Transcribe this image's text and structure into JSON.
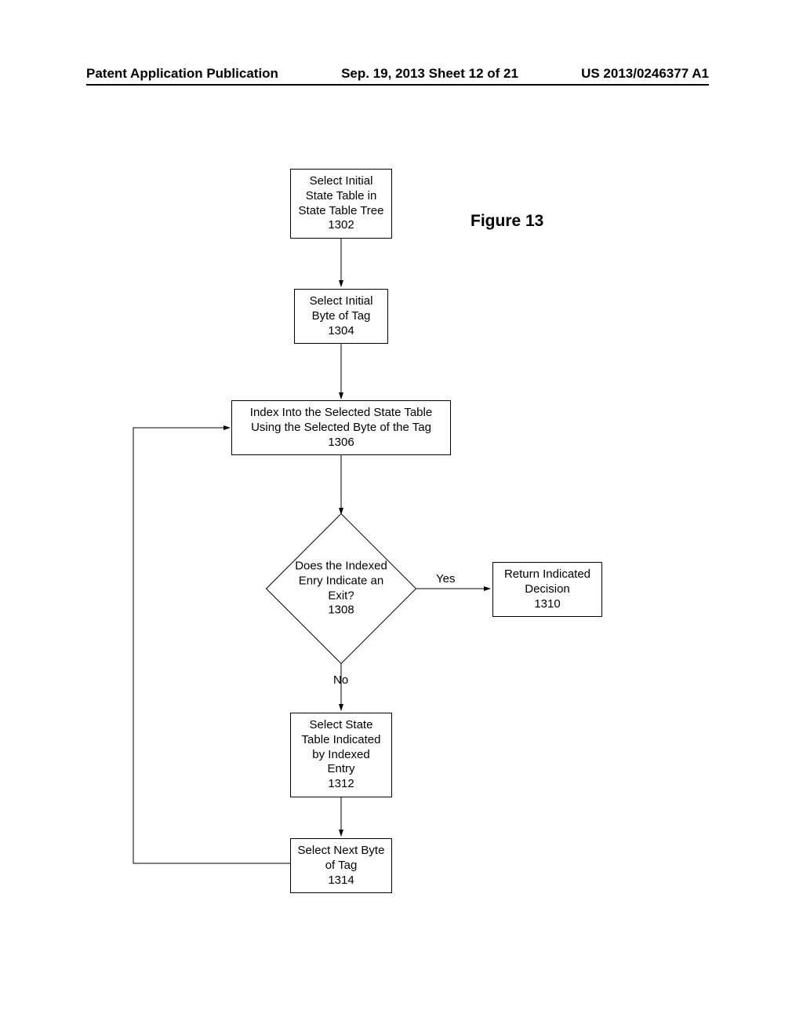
{
  "header": {
    "left": "Patent Application Publication",
    "center": "Sep. 19, 2013  Sheet 12 of 21",
    "right": "US 2013/0246377 A1"
  },
  "figure": {
    "title": "Figure 13"
  },
  "nodes": {
    "n1302": "Select Initial State Table in State Table Tree\n1302",
    "n1304": "Select Initial Byte of Tag\n1304",
    "n1306": "Index Into the Selected State Table Using the Selected Byte of the Tag\n1306",
    "n1308": "Does the Indexed Enry Indicate an Exit?\n1308",
    "n1310": "Return Indicated Decision\n1310",
    "n1312": "Select State Table Indicated by Indexed Entry\n1312",
    "n1314": "Select Next Byte of Tag\n1314"
  },
  "edges": {
    "yes": "Yes",
    "no": "No"
  }
}
